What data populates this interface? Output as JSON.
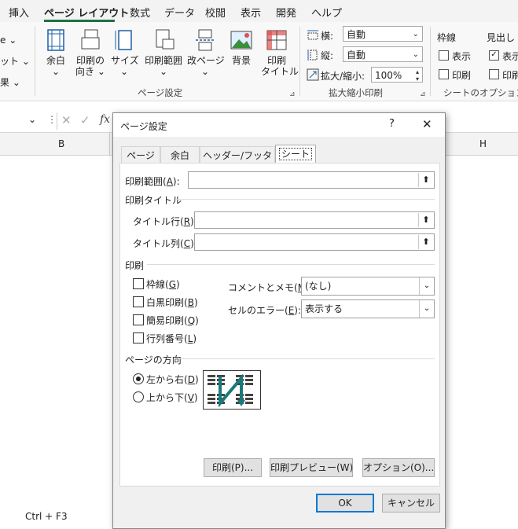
{
  "tabs": {
    "insert": "挿入",
    "page_layout": "ページ レイアウト",
    "formulas": "数式",
    "data": "データ",
    "review": "校閲",
    "view": "表示",
    "developer": "開発",
    "help": "ヘルプ"
  },
  "ribbon": {
    "left_partial": [
      "e ⌄",
      "ット ⌄",
      "果 ⌄"
    ],
    "margins": "余白",
    "orientation_1": "印刷の",
    "orientation_2": "向き",
    "size": "サイズ",
    "print_area_1": "印刷範囲",
    "breaks": "改ページ",
    "background": "背景",
    "print_titles_1": "印刷",
    "print_titles_2": "タイトル",
    "group_page_setup": "ページ設定",
    "width_label": "横:",
    "width_value": "自動",
    "height_label": "縦:",
    "height_value": "自動",
    "scale_label": "拡大/縮小:",
    "scale_value": "100%",
    "group_scale": "拡大縮小印刷",
    "gridlines": "枠線",
    "gl_view": "表示",
    "gl_print": "印刷",
    "headings_partial": "見出し",
    "hd_view": "表示",
    "hd_print": "印刷",
    "group_sheet_options": "シートのオプション"
  },
  "sheet": {
    "col_b": "B",
    "col_h": "H",
    "fx": "fx",
    "bottom_text": "Ctrl + F3"
  },
  "dialog": {
    "title": "ページ設定",
    "help": "?",
    "close": "✕",
    "tabs": [
      "ページ",
      "余白",
      "ヘッダー/フッター",
      "シート"
    ],
    "print_area": "印刷範囲",
    "print_area_key": "A",
    "print_titles": "印刷タイトル",
    "rows_repeat": "タイトル行",
    "rows_key": "R",
    "cols_repeat": "タイトル列",
    "cols_key": "C",
    "print_section": "印刷",
    "gridlines": "枠線",
    "gridlines_key": "G",
    "bw": "白黒印刷",
    "bw_key": "B",
    "draft": "簡易印刷",
    "draft_key": "Q",
    "rowcol": "行列番号",
    "rowcol_key": "L",
    "comments_label": "コメントとメモ",
    "comments_key": "M",
    "comments_value": "(なし)",
    "errors_label": "セルのエラー",
    "errors_key": "E",
    "errors_value": "表示する",
    "page_order": "ページの方向",
    "down_over": "左から右",
    "down_over_key": "D",
    "over_down": "上から下",
    "over_down_key": "V",
    "btn_print": "印刷(P)...",
    "btn_preview": "印刷プレビュー(W)",
    "btn_options": "オプション(O)...",
    "ok": "OK",
    "cancel": "キャンセル"
  },
  "colors": {
    "accent": "#1e7145",
    "focus": "#0078d4"
  }
}
